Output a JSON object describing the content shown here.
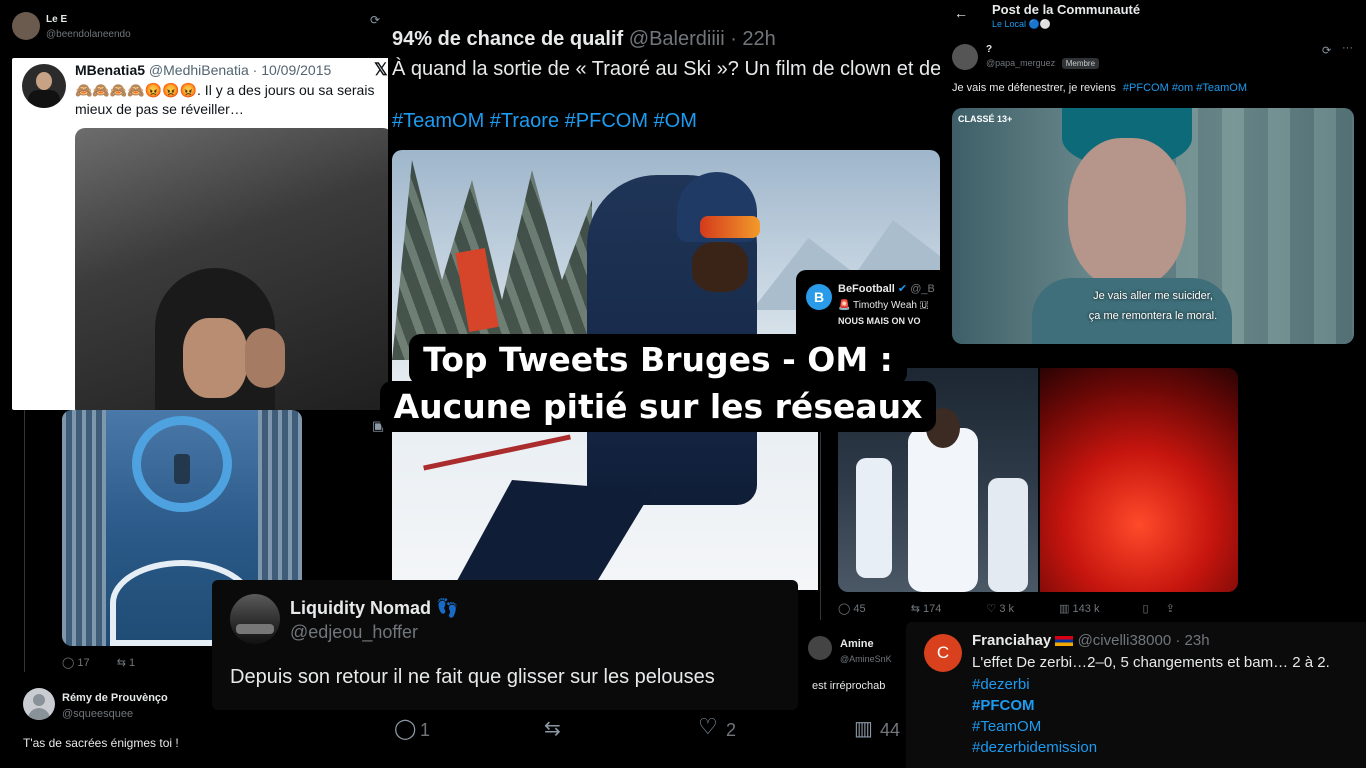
{
  "headline": {
    "line1": "Top Tweets Bruges - OM :",
    "line2": "Aucune pitié sur les réseaux"
  },
  "tweet_le_e": {
    "name": "Le E",
    "handle": "@beendolaneendo"
  },
  "tweet_benatia": {
    "name": "MBenatia5",
    "handle": "@MedhiBenatia",
    "date": "· 10/09/2015",
    "emojis": "🙈🙈🙈🙈😡😡😡",
    "text": ". Il y a des jours ou sa serais mieux de pas se réveiller…"
  },
  "tweet_balerdi": {
    "name": "94% de chance de qualif",
    "handle": "@Balerdiiii",
    "time": "· 22h",
    "text": "À quand la sortie de « Traoré au Ski »? Un film de clown et de",
    "hashtags": "#TeamOM #Traore #PFCOM #OM",
    "stats": {
      "replies": "1",
      "likes": "2",
      "views": "44"
    }
  },
  "tweet_community": {
    "header": "Post de la Communauté",
    "sub": "Le Local 🔵⚪",
    "name": "?",
    "handle": "@papa_merguez",
    "badge": "Membre",
    "text": "Je vais me défenestrer, je reviens",
    "hashtags": "#PFCOM #om #TeamOM",
    "rating": "CLASSÉ 13+",
    "subtitle1": "Je vais aller me suicider,",
    "subtitle2": "ça me remontera le moral."
  },
  "tweet_befootball": {
    "name": "BeFootball",
    "handle": "@_B",
    "line1": "🚨 Timothy Weah 🇺",
    "line2": "NOUS MAIS ON VO",
    "stats": {
      "replies": "45",
      "retweets": "174",
      "likes": "3 k",
      "views": "143 k"
    }
  },
  "tweet_club": {
    "stats": {
      "replies": "17",
      "retweets": "1"
    }
  },
  "tweet_remy": {
    "name": "Rémy de Prouvènço",
    "handle": "@squeesquee",
    "text": "T'as de sacrées énigmes toi !"
  },
  "tweet_liquidity": {
    "name": "Liquidity Nomad",
    "emoji": "👣",
    "handle": "@edjeou_hoffer",
    "text": "Depuis son retour il ne fait que glisser sur les pelouses"
  },
  "tweet_amine": {
    "name": "Amine",
    "handle": "@AmineSnK",
    "text": "est irréprochab"
  },
  "tweet_franciahay": {
    "initial": "C",
    "name": "Franciahay",
    "handle": "@civelli38000",
    "time": "· 23h",
    "text": "L'effet De zerbi…2–0, 5 changements et bam… 2 à 2.",
    "tags": [
      "#dezerbi",
      "#PFCOM",
      "#TeamOM",
      "#dezerbidemission"
    ]
  },
  "colors": {
    "link": "#1d9bf0",
    "overlay_bg": "#000000",
    "avatar_red": "#d9411e"
  }
}
